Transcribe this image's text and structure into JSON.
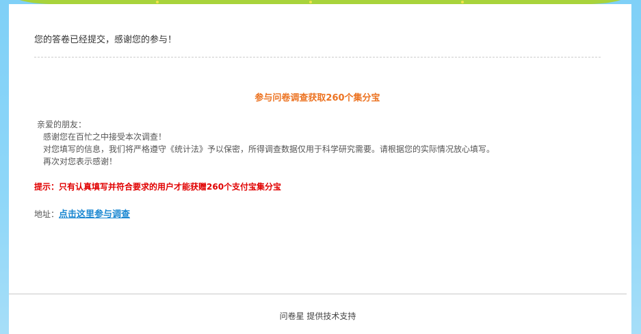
{
  "header": {
    "thanks_message": "您的答卷已经提交，感谢您的参与！"
  },
  "main": {
    "headline": "参与问卷调查获取260个集分宝",
    "greeting": "亲爱的朋友：",
    "paragraphs": [
      "感谢您在百忙之中接受本次调查！",
      "对您填写的信息，我们将严格遵守《统计法》予以保密，所得调查数据仅用于科学研究需要。请根据您的实际情况放心填写。",
      "再次对您表示感谢！"
    ],
    "tip": "提示：只有认真填写并符合要求的用户才能获赠260个支付宝集分宝",
    "address_label": "地址：",
    "address_link": "点击这里参与调查"
  },
  "footer": {
    "credit": "问卷星 提供技术支持"
  },
  "colors": {
    "background": "#8fd7f8",
    "headline": "#ec7322",
    "tip": "#e00000",
    "link": "#1a87d1"
  }
}
